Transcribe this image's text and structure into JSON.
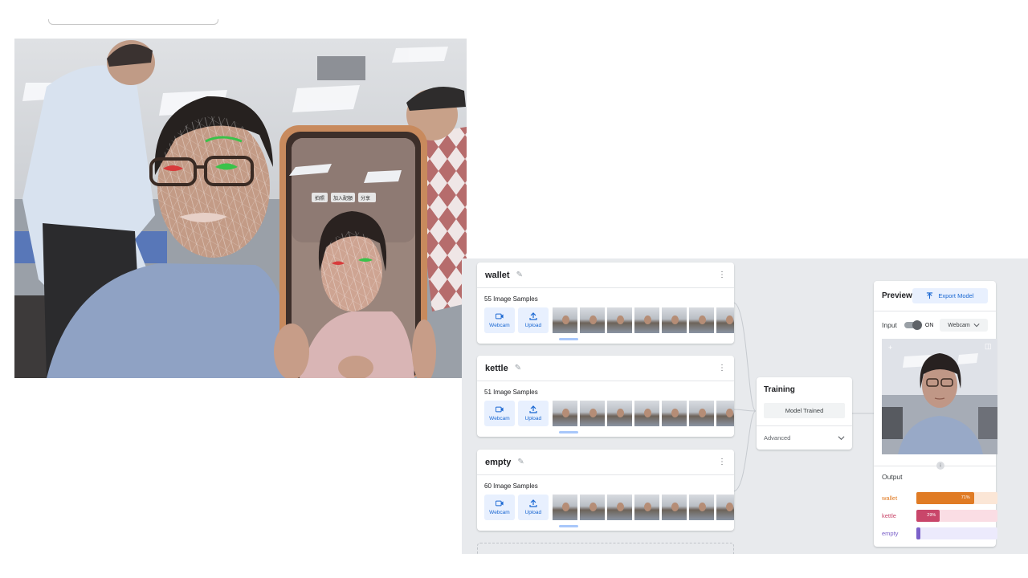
{
  "photo": {
    "phone_overlay_labels": [
      "拍照",
      "加入配額",
      "分享"
    ]
  },
  "classes": [
    {
      "name": "wallet",
      "samples_label": "55 Image Samples"
    },
    {
      "name": "kettle",
      "samples_label": "51 Image Samples"
    },
    {
      "name": "empty",
      "samples_label": "60 Image Samples"
    }
  ],
  "source_buttons": {
    "webcam": "Webcam",
    "upload": "Upload"
  },
  "training": {
    "title": "Training",
    "button": "Model Trained",
    "advanced": "Advanced"
  },
  "preview": {
    "title": "Preview",
    "export_label": "Export Model",
    "input_label": "Input",
    "toggle_state": "ON",
    "source_select": "Webcam",
    "output_title": "Output",
    "outputs": [
      {
        "label": "wallet",
        "percent": 71,
        "percent_label": "71%",
        "color": "#e07b24",
        "track_color": "#fbe6d6"
      },
      {
        "label": "kettle",
        "percent": 29,
        "percent_label": "29%",
        "color": "#c9466a",
        "track_color": "#fadde4"
      },
      {
        "label": "empty",
        "percent": 0,
        "percent_label": "",
        "color": "#7b61c9",
        "track_color": "#eceafc"
      }
    ]
  }
}
